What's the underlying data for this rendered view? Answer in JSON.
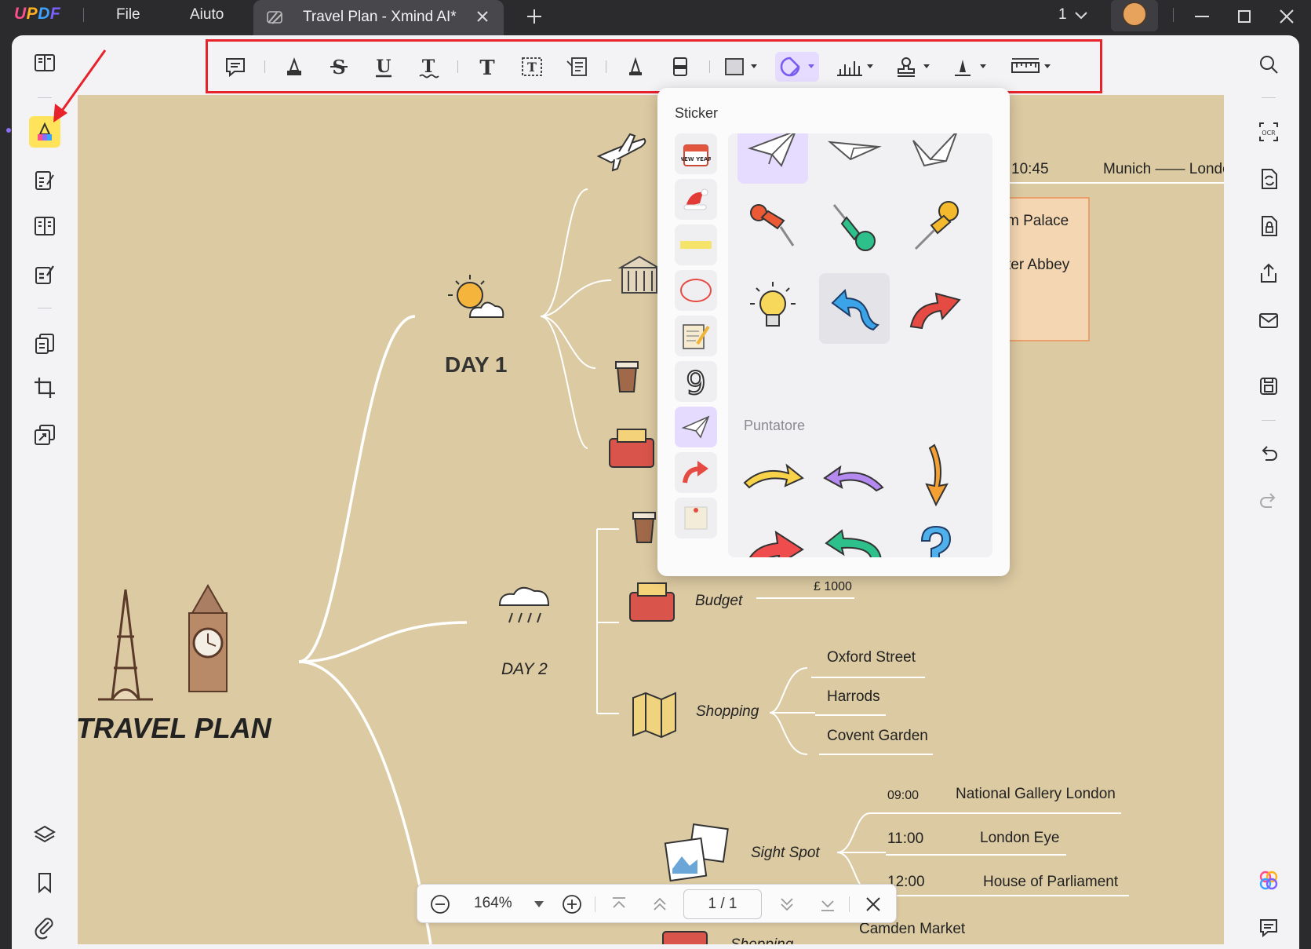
{
  "app": {
    "logo": "UPDF",
    "menu": [
      "File",
      "Aiuto"
    ],
    "tab_title": "Travel Plan - Xmind AI*",
    "page_indicator": "1"
  },
  "toolbar": {
    "tools": [
      "comment-icon",
      "highlight-icon",
      "strikethrough-icon",
      "underline-icon",
      "squiggly-icon",
      "text-icon",
      "textbox-icon",
      "text-callout-icon",
      "pencil-icon",
      "eraser-icon",
      "shape-icon",
      "sticker-icon",
      "chart-icon",
      "stamp-icon",
      "signature-icon",
      "measure-icon"
    ],
    "active_tool": "sticker-icon"
  },
  "sticker_panel": {
    "title": "Sticker",
    "section_label": "Puntatore",
    "categories": [
      "new-year",
      "santa-hat",
      "tape",
      "circle",
      "notepad",
      "number-nine",
      "paper-plane",
      "curved-arrow",
      "memo-pin"
    ],
    "active_category": "paper-plane"
  },
  "mindmap": {
    "title": "TRAVEL PLAN",
    "day1": "DAY 1",
    "day2": "DAY 2",
    "time_1045": "10:45",
    "munich": "Munich —— Londo",
    "palace": "m Palace",
    "abbey": "ter Abbey",
    "budget": "Budget",
    "budget_value": "£ 1000",
    "shopping": "Shopping",
    "oxford": "Oxford Street",
    "harrods": "Harrods",
    "covent": "Covent Garden",
    "sight_spot": "Sight Spot",
    "t0900": "09:00",
    "gallery": "National Gallery London",
    "t1100": "11:00",
    "eye": "London Eye",
    "t1200": "12:00",
    "parliament": "House of Parliament",
    "camden": "Camden Market",
    "shopping2": "Shopping"
  },
  "bottom_bar": {
    "zoom": "164%",
    "page": "1 / 1"
  },
  "colors": {
    "canvas": "#dccaa2",
    "accent": "#8e6cf5",
    "highlight": "#e8222b"
  }
}
